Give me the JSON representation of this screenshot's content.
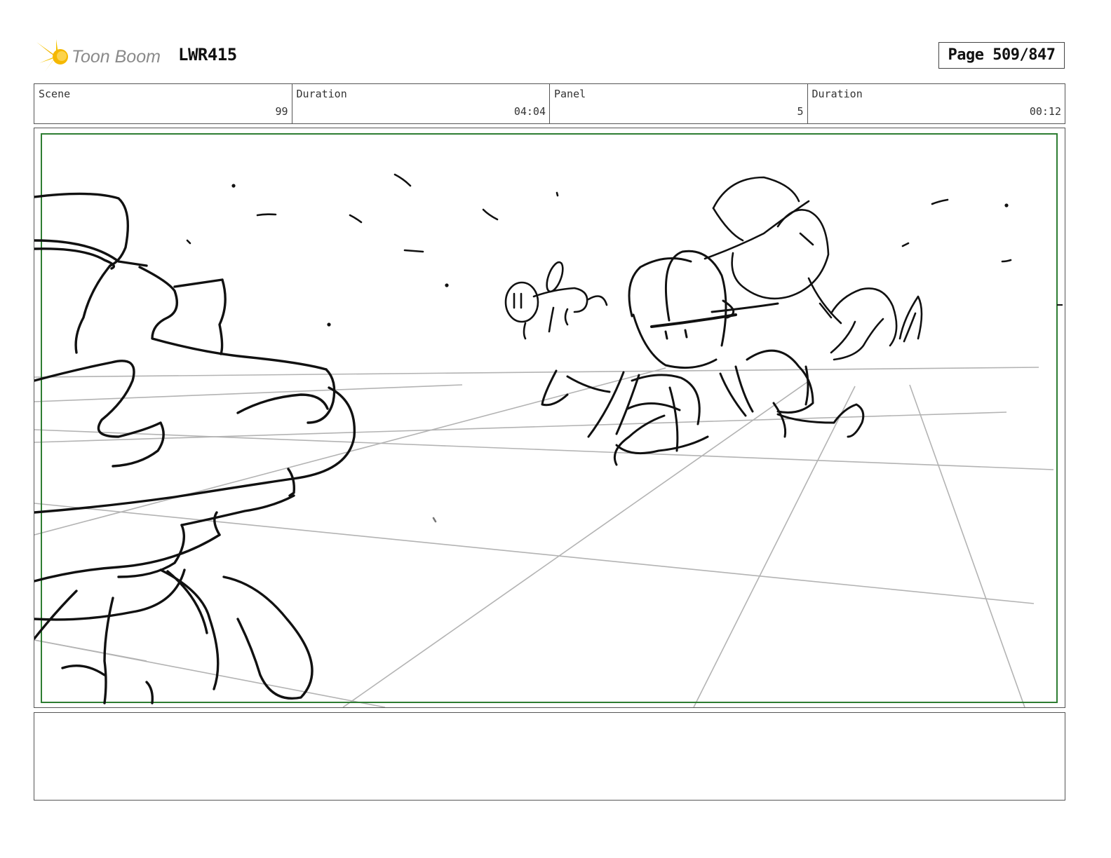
{
  "header": {
    "logo_text": "Toon Boom",
    "project_code": "LWR415",
    "page_label": "Page 509/847"
  },
  "info_row": [
    {
      "label": "Scene",
      "value": "99"
    },
    {
      "label": "Duration",
      "value": "04:04"
    },
    {
      "label": "Panel",
      "value": "5"
    },
    {
      "label": "Duration",
      "value": "00:12"
    }
  ],
  "panel": {
    "safe_frame_color": "#2e7d32",
    "perspective_grid_color": "#b3b3b3",
    "sketch_color": "#111111"
  },
  "notes": {
    "text": ""
  }
}
